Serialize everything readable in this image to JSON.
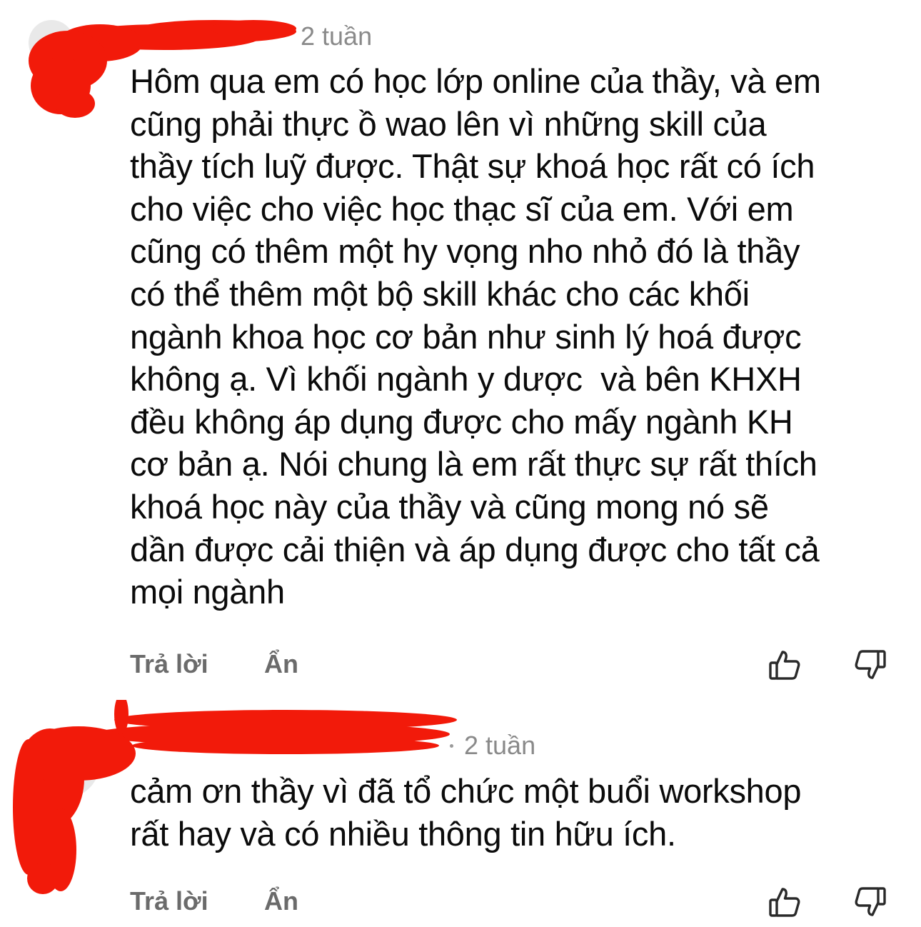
{
  "colors": {
    "background": "#ffffff",
    "text": "#0b0b0b",
    "muted": "#8a8a8a",
    "action": "#6b6b6b",
    "redaction": "#f21a0a"
  },
  "comments": [
    {
      "timestamp": "2 tuần",
      "lines": [
        "Hôm qua em có học lớp online của thầy, và em",
        "cũng phải thực ồ wao lên vì những skill của",
        "thầy tích luỹ được. Thật sự khoá học rất có ích",
        "cho việc cho việc học thạc sĩ của em. Với em",
        "cũng có thêm một hy vọng nho nhỏ đó là thầy",
        "có thể thêm một bộ skill khác cho các khối",
        "ngành khoa học cơ bản như sinh lý hoá được",
        "không ạ. Vì khối ngành y dược  và bên KHXH",
        "đều không áp dụng được cho mấy ngành KH",
        "cơ bản ạ. Nói chung là em rất thực sự rất thích",
        "khoá học này của thầy và cũng mong nó sẽ",
        "dần được cải thiện và áp dụng được cho tất cả",
        "mọi ngành"
      ],
      "actions": {
        "reply": "Trả lời",
        "hide": "Ẩn"
      },
      "icons": {
        "like": "thumbs-up-icon",
        "dislike": "thumbs-down-icon"
      }
    },
    {
      "timestamp": "2 tuần",
      "lines": [
        "cảm ơn thầy vì đã tổ chức một buổi workshop",
        "rất hay và có nhiều thông tin hữu ích."
      ],
      "actions": {
        "reply": "Trả lời",
        "hide": "Ẩn"
      },
      "icons": {
        "like": "thumbs-up-icon",
        "dislike": "thumbs-down-icon"
      }
    }
  ]
}
